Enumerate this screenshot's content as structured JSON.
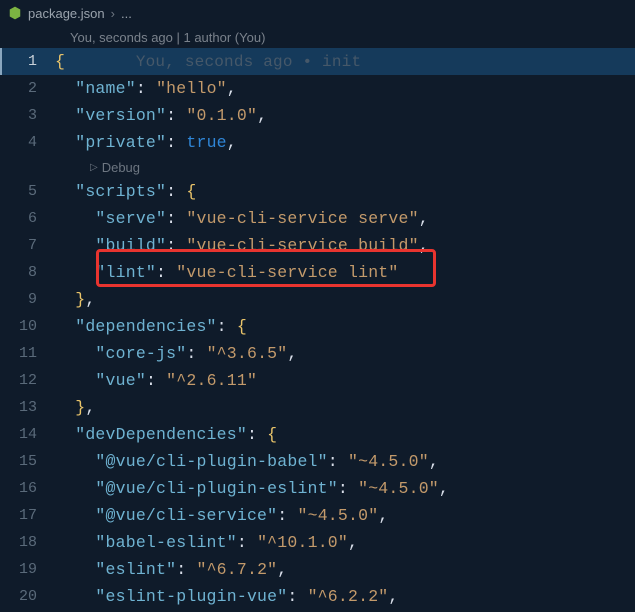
{
  "breadcrumb": {
    "file": "package.json",
    "tail": "..."
  },
  "blame": {
    "header": "You, seconds ago | 1 author (You)",
    "inline": "You, seconds ago • init"
  },
  "debug_lens": "Debug",
  "lines": [
    {
      "n": 1,
      "indent": 0,
      "type": "open",
      "active": true,
      "inline_blame": true
    },
    {
      "n": 2,
      "indent": 1,
      "type": "kv_str",
      "key": "name",
      "val": "hello",
      "comma": true
    },
    {
      "n": 3,
      "indent": 1,
      "type": "kv_str",
      "key": "version",
      "val": "0.1.0",
      "comma": true
    },
    {
      "n": 4,
      "indent": 1,
      "type": "kv_bool",
      "key": "private",
      "val": "true",
      "comma": true
    },
    {
      "n": 5,
      "indent": 1,
      "type": "kv_open",
      "key": "scripts"
    },
    {
      "n": 6,
      "indent": 2,
      "type": "kv_str",
      "key": "serve",
      "val": "vue-cli-service serve",
      "comma": true
    },
    {
      "n": 7,
      "indent": 2,
      "type": "kv_str",
      "key": "build",
      "val": "vue-cli-service build",
      "comma": true
    },
    {
      "n": 8,
      "indent": 2,
      "type": "kv_str",
      "key": "lint",
      "val": "vue-cli-service lint"
    },
    {
      "n": 9,
      "indent": 1,
      "type": "close",
      "comma": true
    },
    {
      "n": 10,
      "indent": 1,
      "type": "kv_open",
      "key": "dependencies"
    },
    {
      "n": 11,
      "indent": 2,
      "type": "kv_str",
      "key": "core-js",
      "val": "^3.6.5",
      "comma": true
    },
    {
      "n": 12,
      "indent": 2,
      "type": "kv_str",
      "key": "vue",
      "val": "^2.6.11"
    },
    {
      "n": 13,
      "indent": 1,
      "type": "close",
      "comma": true
    },
    {
      "n": 14,
      "indent": 1,
      "type": "kv_open",
      "key": "devDependencies"
    },
    {
      "n": 15,
      "indent": 2,
      "type": "kv_str",
      "key": "@vue/cli-plugin-babel",
      "val": "~4.5.0",
      "comma": true
    },
    {
      "n": 16,
      "indent": 2,
      "type": "kv_str",
      "key": "@vue/cli-plugin-eslint",
      "val": "~4.5.0",
      "comma": true
    },
    {
      "n": 17,
      "indent": 2,
      "type": "kv_str",
      "key": "@vue/cli-service",
      "val": "~4.5.0",
      "comma": true
    },
    {
      "n": 18,
      "indent": 2,
      "type": "kv_str",
      "key": "babel-eslint",
      "val": "^10.1.0",
      "comma": true
    },
    {
      "n": 19,
      "indent": 2,
      "type": "kv_str",
      "key": "eslint",
      "val": "^6.7.2",
      "comma": true
    },
    {
      "n": 20,
      "indent": 2,
      "type": "kv_str",
      "key": "eslint-plugin-vue",
      "val": "^6.2.2",
      "comma": true
    }
  ],
  "highlight_line": 8
}
